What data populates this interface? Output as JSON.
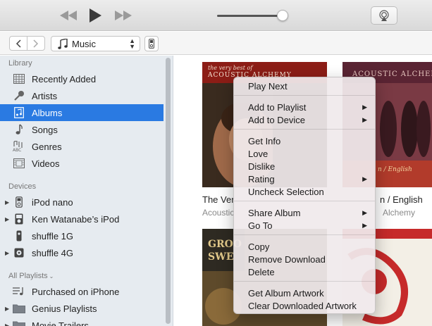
{
  "toolbar": {
    "rewind_icon": "rewind-icon",
    "play_icon": "play-icon",
    "forward_icon": "fast-forward-icon",
    "volume_level": 0.92,
    "airplay_icon": "airplay-icon"
  },
  "nav": {
    "media_type": "Music",
    "media_icon": "music-note-icon",
    "device_icon": "ipod-icon"
  },
  "sidebar": {
    "library_title": "Library",
    "library_items": [
      {
        "label": "Recently Added",
        "icon": "grid-icon"
      },
      {
        "label": "Artists",
        "icon": "microphone-icon"
      },
      {
        "label": "Albums",
        "icon": "album-icon",
        "selected": true
      },
      {
        "label": "Songs",
        "icon": "music-note-icon"
      },
      {
        "label": "Genres",
        "icon": "genres-icon"
      },
      {
        "label": "Videos",
        "icon": "film-icon"
      }
    ],
    "devices_title": "Devices",
    "device_items": [
      {
        "label": "iPod nano",
        "icon": "ipod-nano-icon"
      },
      {
        "label": "Ken Watanabe’s iPod",
        "icon": "ipod-icon"
      },
      {
        "label": "shuffle 1G",
        "icon": "shuffle-icon"
      },
      {
        "label": "shuffle 4G",
        "icon": "shuffle-square-icon"
      }
    ],
    "playlists_title": "All Playlists",
    "playlist_items": [
      {
        "label": "Purchased on iPhone",
        "icon": "playlist-icon"
      },
      {
        "label": "Genius Playlists",
        "icon": "folder-icon"
      },
      {
        "label": "Movie Trailers",
        "icon": "folder-icon"
      }
    ]
  },
  "albums": [
    {
      "title": "The Ver",
      "artist": "Acoustic",
      "cover_text_1": "the very best of",
      "cover_text_2": "ACOUSTIC ALCHEMY"
    },
    {
      "title": "n / English",
      "artist": "Alchemy",
      "cover_text_1": "ACOUSTIC ALCHEMY",
      "cover_text_2": "n / English"
    }
  ],
  "context_menu": {
    "items": [
      {
        "label": "Play Next"
      },
      {
        "label": "Add to Playlist",
        "submenu": true
      },
      {
        "label": "Add to Device",
        "submenu": true
      },
      {
        "label": "Get Info"
      },
      {
        "label": "Love"
      },
      {
        "label": "Dislike"
      },
      {
        "label": "Rating",
        "submenu": true
      },
      {
        "label": "Uncheck Selection"
      },
      {
        "label": "Share Album",
        "submenu": true
      },
      {
        "label": "Go To",
        "submenu": true
      },
      {
        "label": "Copy"
      },
      {
        "label": "Remove Download"
      },
      {
        "label": "Delete"
      },
      {
        "label": "Get Album Artwork"
      },
      {
        "label": "Clear Downloaded Artwork"
      }
    ],
    "submenu_arrow": "▶"
  },
  "colors": {
    "selection": "#2a7ae2",
    "sidebar_bg": "#e6ebf0"
  }
}
